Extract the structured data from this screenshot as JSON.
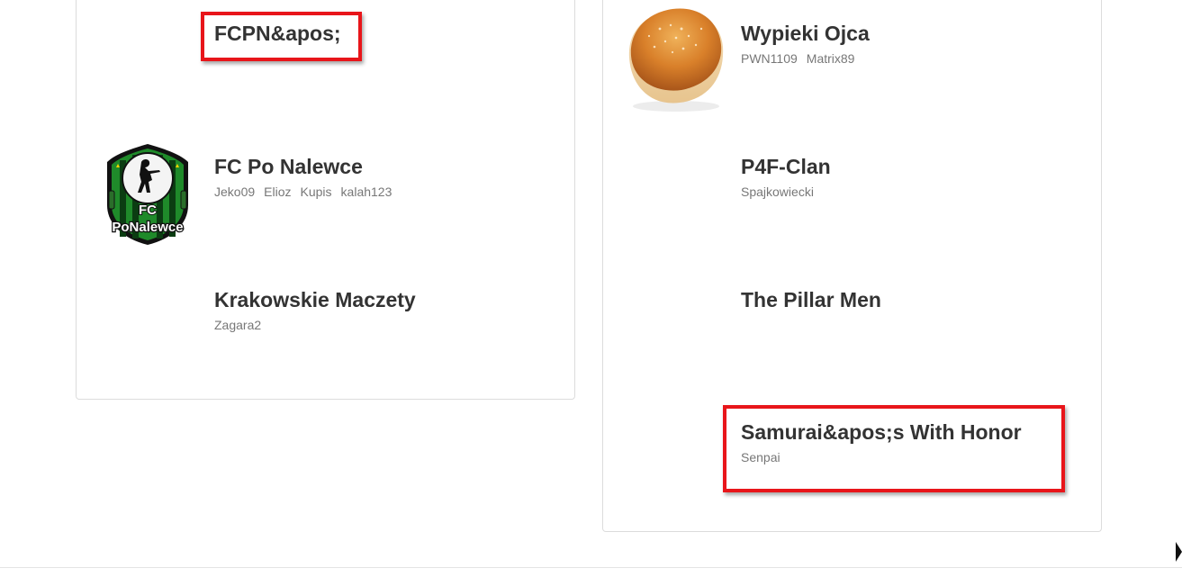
{
  "left_column": {
    "teams": [
      {
        "name": "FCPN&apos;",
        "members": []
      },
      {
        "name": "FC Po Nalewce",
        "members": [
          "Jeko09",
          "Elioz",
          "Kupis",
          "kalah123"
        ],
        "logo": {
          "icon": "fc-po-nalewce-logo",
          "text_top": "FC",
          "text_bottom": "PoNalewce"
        }
      },
      {
        "name": "Krakowskie Maczety",
        "members": [
          "Zagara2"
        ]
      }
    ]
  },
  "right_column": {
    "teams": [
      {
        "name": "Wypieki Ojca",
        "members": [
          "PWN1109",
          "Matrix89"
        ],
        "logo": {
          "icon": "sweet-bun-logo"
        }
      },
      {
        "name": "P4F-Clan",
        "members": [
          "Spajkowiecki"
        ]
      },
      {
        "name": "The Pillar Men",
        "members": []
      },
      {
        "name": "Samurai&apos;s With Honor",
        "members": [
          "Senpai"
        ]
      }
    ]
  },
  "colors": {
    "highlight": "#e8151a",
    "team_name": "#333333",
    "member": "#777777",
    "border": "#dcdcdc"
  }
}
